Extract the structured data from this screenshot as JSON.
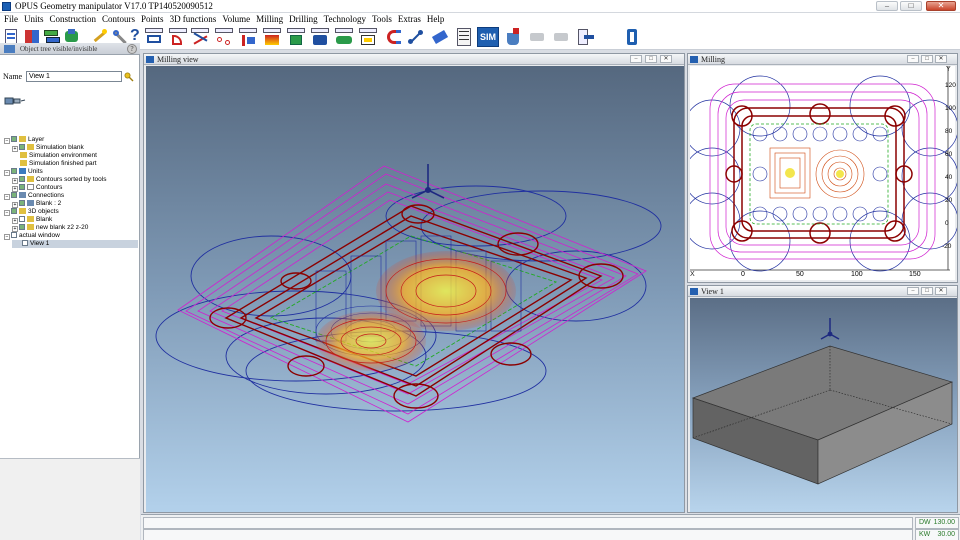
{
  "window": {
    "title": "OPUS Geometry manipulator V17.0   TP140520090512"
  },
  "menu": [
    "File",
    "Units",
    "Construction",
    "Contours",
    "Points",
    "3D functions",
    "Volume",
    "Milling",
    "Drilling",
    "Technology",
    "Tools",
    "Extras",
    "Help"
  ],
  "toolbar": {
    "sim_label": "SIM"
  },
  "left_panel": {
    "header": "Object tree visible/invisible",
    "name_label": "Name",
    "name_value": "View 1",
    "tree": [
      {
        "label": "Layer",
        "indent": 0
      },
      {
        "label": "Simulation blank",
        "indent": 1
      },
      {
        "label": "Simulation environment",
        "indent": 1
      },
      {
        "label": "Simulation finished part",
        "indent": 1
      },
      {
        "label": "Units",
        "indent": 0
      },
      {
        "label": "Contours sorted by tools",
        "indent": 1
      },
      {
        "label": "Contours",
        "indent": 1
      },
      {
        "label": "Connections",
        "indent": 0
      },
      {
        "label": "Blank : 2",
        "indent": 1
      },
      {
        "label": "3D objects",
        "indent": 0
      },
      {
        "label": "Blank",
        "indent": 1
      },
      {
        "label": "new blank z2 z-20",
        "indent": 1
      },
      {
        "label": "actual window",
        "indent": 0
      },
      {
        "label": "View 1",
        "indent": 1
      }
    ]
  },
  "views": {
    "milling_view": {
      "title": "Milling view"
    },
    "milling": {
      "title": "Milling",
      "x_label": "X",
      "y_label": "Y",
      "x_ticks": [
        "0",
        "50",
        "100",
        "150"
      ],
      "y_ticks": [
        "120",
        "100",
        "80",
        "60",
        "40",
        "20",
        "0",
        "-20"
      ]
    },
    "view1": {
      "title": "View 1"
    }
  },
  "window_controls": {
    "minimize": "–",
    "maximize": "□",
    "close": "✕"
  },
  "status": [
    {
      "label": "DW",
      "value": "130.00"
    },
    {
      "label": "KW",
      "value": "30.00"
    }
  ],
  "colors": {
    "accent": "#1f5fb0",
    "toolpath_red": "#8b0000",
    "toolpath_magenta": "#d020d0",
    "toolpath_blue": "#1a3aa0",
    "toolpath_yellow": "#f0e020"
  }
}
